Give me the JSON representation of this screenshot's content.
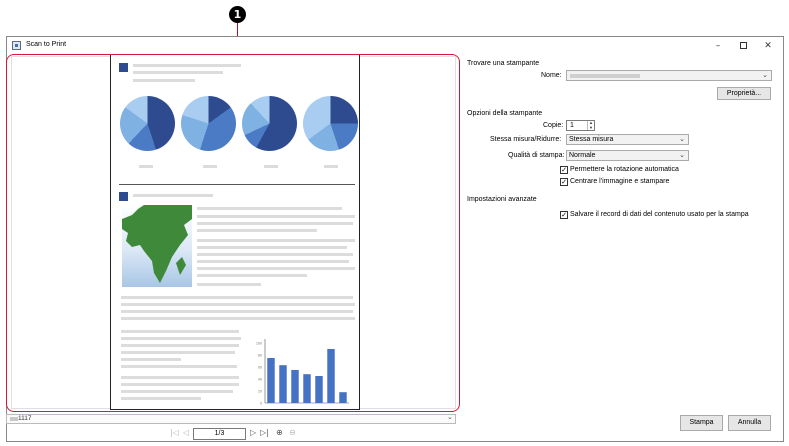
{
  "callout": {
    "number": "1"
  },
  "window": {
    "title": "Scan to Print",
    "minimize": "–",
    "close": "✕"
  },
  "preview": {
    "chart_data": {
      "type": "bar",
      "values": [
        75,
        63,
        55,
        48,
        45,
        90,
        18
      ],
      "ylim": [
        0,
        100
      ],
      "tick_labels": [
        "100",
        "80",
        "60",
        "40",
        "20",
        "0"
      ]
    }
  },
  "bottom": {
    "file_label": "1117",
    "page_field": "1/3"
  },
  "nav": {
    "first": "|◁",
    "prev": "◁",
    "next": "▷",
    "last": "▷|",
    "zoom_in": "⊕",
    "zoom_out": "⊖"
  },
  "printer": {
    "section_title": "Trovare una stampante",
    "name_label": "Nome:",
    "properties_button": "Proprietà..."
  },
  "options": {
    "section_title": "Opzioni della stampante",
    "copies_label": "Copie:",
    "copies_value": "1",
    "scale_label": "Stessa misura/Ridurre:",
    "scale_value": "Stessa misura",
    "quality_label": "Qualità di stampa:",
    "quality_value": "Normale",
    "auto_rotate_label": "Permettere la rotazione automatica",
    "center_label": "Centrare l'immagine e stampare"
  },
  "advanced": {
    "section_title": "Impostazioni avanzate",
    "save_record_label": "Salvare il record di dati del contenuto usato per la stampa"
  },
  "buttons": {
    "print": "Stampa",
    "cancel": "Annulla"
  },
  "icons": {
    "check": "✓",
    "chevron": "⌄",
    "spin_up": "▲",
    "spin_down": "▼"
  }
}
